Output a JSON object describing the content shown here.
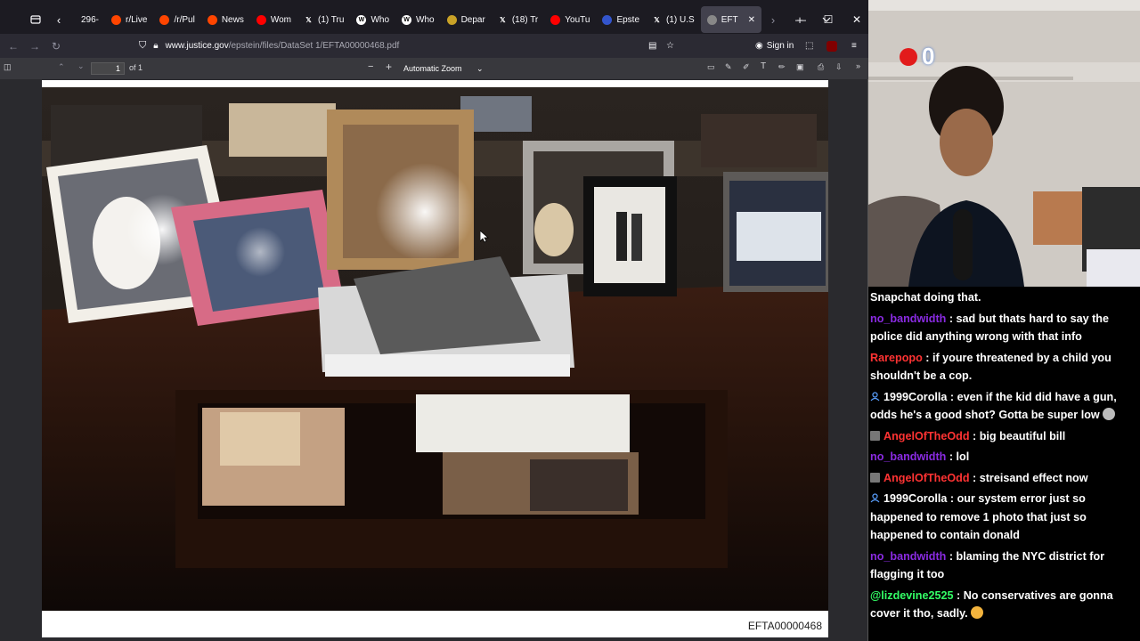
{
  "browser": {
    "tabs": [
      {
        "label": "296-",
        "favicon": "truncated",
        "color": "#888888"
      },
      {
        "label": "r/Live",
        "favicon": "reddit-icon",
        "color": "#ff4500"
      },
      {
        "label": "/r/Pul",
        "favicon": "reddit-icon",
        "color": "#ff4500"
      },
      {
        "label": "News",
        "favicon": "reddit-icon",
        "color": "#ff4500"
      },
      {
        "label": "Wom",
        "favicon": "youtube-icon",
        "color": "#ff0000"
      },
      {
        "label": "(1) Tru",
        "favicon": "x-icon",
        "color": "#ffffff"
      },
      {
        "label": "Who",
        "favicon": "wiki-icon",
        "color": "#ffffff"
      },
      {
        "label": "Who",
        "favicon": "wiki-icon",
        "color": "#ffffff"
      },
      {
        "label": "Depar",
        "favicon": "seal-icon",
        "color": "#c9a227"
      },
      {
        "label": "(18) Tr",
        "favicon": "x-icon",
        "color": "#ffffff"
      },
      {
        "label": "YouTu",
        "favicon": "youtube-icon",
        "color": "#ff0000"
      },
      {
        "label": "Epste",
        "favicon": "news-icon",
        "color": "#3355cc"
      },
      {
        "label": "(1) U.S",
        "favicon": "x-icon",
        "color": "#ffffff"
      },
      {
        "label": "EFT",
        "favicon": "pdf-icon",
        "color": "#888888",
        "active": true
      }
    ],
    "url_host": "www.justice.gov",
    "url_path": "/epstein/files/DataSet 1/EFTA00000468.pdf",
    "sign_in_label": "Sign in",
    "pdf": {
      "page_value": "1",
      "page_count": "of 1",
      "zoom": "Automatic Zoom",
      "document_id": "EFTA00000468"
    }
  },
  "stream": {
    "webcam_overlay_digit": "0",
    "chat": [
      {
        "user": "",
        "color": "#ffffff",
        "badge": "",
        "text": "Snapchat doing that.",
        "emote": ""
      },
      {
        "user": "no_bandwidth",
        "color": "#8a2be2",
        "badge": "",
        "text": " : sad but thats hard to say the police did anything wrong with that info",
        "emote": ""
      },
      {
        "user": "Rarepopo",
        "color": "#ff3333",
        "badge": "",
        "text": " : if youre threatened by a child you shouldn't be a cop.",
        "emote": ""
      },
      {
        "user": "1999Corolla",
        "color": "#ffffff",
        "badge": "person",
        "text": " : even if the kid did have a gun, odds he's a good shot? Gotta be super low",
        "emote": "grimace-emote"
      },
      {
        "user": "AngelOfTheOdd",
        "color": "#ff3333",
        "badge": "square",
        "text": " : big beautiful bill",
        "emote": ""
      },
      {
        "user": "no_bandwidth",
        "color": "#8a2be2",
        "badge": "",
        "text": " : lol",
        "emote": ""
      },
      {
        "user": "AngelOfTheOdd",
        "color": "#ff3333",
        "badge": "square",
        "text": " : streisand effect now",
        "emote": ""
      },
      {
        "user": "1999Corolla",
        "color": "#ffffff",
        "badge": "person",
        "text": " : our system error just so happened to remove 1 photo that just so happened to contain donald",
        "emote": ""
      },
      {
        "user": "no_bandwidth",
        "color": "#8a2be2",
        "badge": "",
        "text": " : blaming the NYC district for flagging it too",
        "emote": ""
      },
      {
        "user": "@lizdevine2525",
        "color": "#33ff66",
        "badge": "",
        "text": " : No conservatives are gonna cover it tho, sadly.",
        "emote": "worried-emote"
      }
    ]
  }
}
